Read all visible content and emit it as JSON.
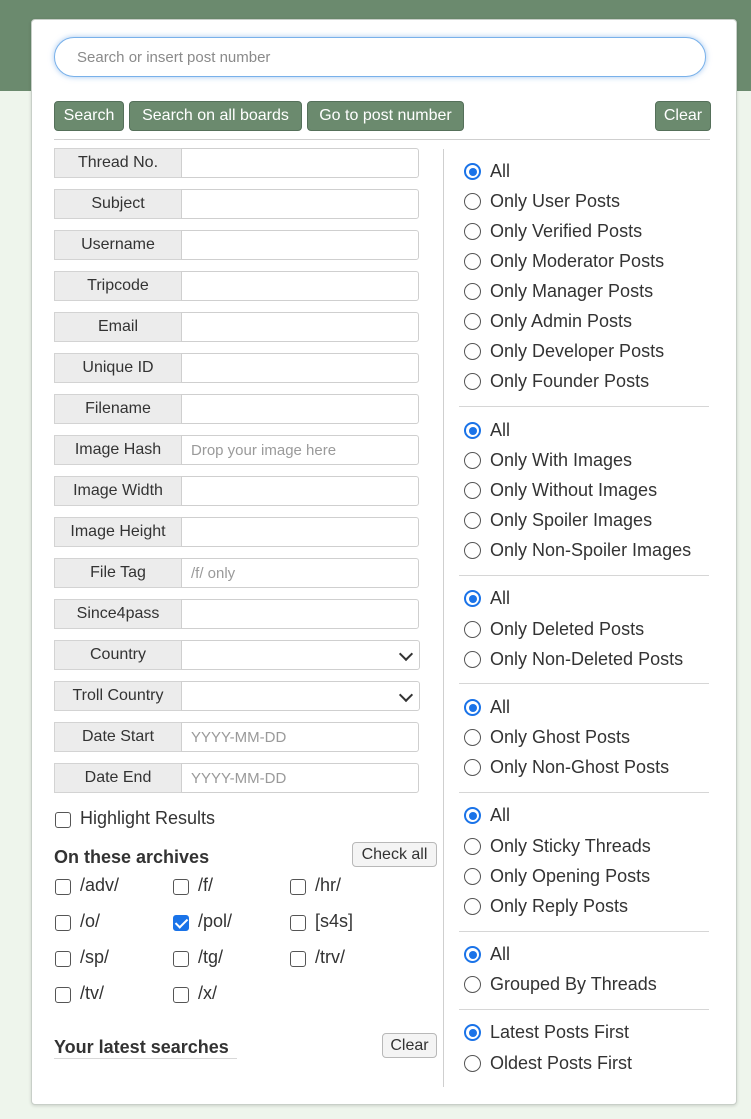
{
  "search": {
    "placeholder": "Search or insert post number"
  },
  "toolbar": {
    "search_label": "Search",
    "search_all_label": "Search on all boards",
    "goto_label": "Go to post number",
    "clear_label": "Clear"
  },
  "fields": {
    "thread_no": {
      "label": "Thread No.",
      "value": "",
      "placeholder": ""
    },
    "subject": {
      "label": "Subject",
      "value": "",
      "placeholder": ""
    },
    "username": {
      "label": "Username",
      "value": "",
      "placeholder": ""
    },
    "tripcode": {
      "label": "Tripcode",
      "value": "",
      "placeholder": ""
    },
    "email": {
      "label": "Email",
      "value": "",
      "placeholder": ""
    },
    "unique_id": {
      "label": "Unique ID",
      "value": "",
      "placeholder": ""
    },
    "filename": {
      "label": "Filename",
      "value": "",
      "placeholder": ""
    },
    "image_hash": {
      "label": "Image Hash",
      "value": "",
      "placeholder": "Drop your image here"
    },
    "image_width": {
      "label": "Image Width",
      "value": "",
      "placeholder": ""
    },
    "image_height": {
      "label": "Image Height",
      "value": "",
      "placeholder": ""
    },
    "file_tag": {
      "label": "File Tag",
      "value": "",
      "placeholder": "/f/ only"
    },
    "since4pass": {
      "label": "Since4pass",
      "value": "",
      "placeholder": ""
    },
    "country": {
      "label": "Country",
      "selected": ""
    },
    "troll_country": {
      "label": "Troll Country",
      "selected": ""
    },
    "date_start": {
      "label": "Date Start",
      "value": "",
      "placeholder": "YYYY-MM-DD"
    },
    "date_end": {
      "label": "Date End",
      "value": "",
      "placeholder": "YYYY-MM-DD"
    }
  },
  "highlight": {
    "label": "Highlight Results",
    "checked": false
  },
  "archives": {
    "heading": "On these archives",
    "check_all_label": "Check all",
    "boards": [
      {
        "label": "/adv/",
        "checked": false
      },
      {
        "label": "/f/",
        "checked": false
      },
      {
        "label": "/hr/",
        "checked": false
      },
      {
        "label": "/o/",
        "checked": false
      },
      {
        "label": "/pol/",
        "checked": true
      },
      {
        "label": "[s4s]",
        "checked": false
      },
      {
        "label": "/sp/",
        "checked": false
      },
      {
        "label": "/tg/",
        "checked": false
      },
      {
        "label": "/trv/",
        "checked": false
      },
      {
        "label": "/tv/",
        "checked": false
      },
      {
        "label": "/x/",
        "checked": false
      }
    ]
  },
  "latest": {
    "heading": "Your latest searches",
    "clear_label": "Clear"
  },
  "filters": {
    "poster_type": {
      "selected": "All",
      "options": [
        "All",
        "Only User Posts",
        "Only Verified Posts",
        "Only Moderator Posts",
        "Only Manager Posts",
        "Only Admin Posts",
        "Only Developer Posts",
        "Only Founder Posts"
      ]
    },
    "images": {
      "selected": "All",
      "options": [
        "All",
        "Only With Images",
        "Only Without Images",
        "Only Spoiler Images",
        "Only Non-Spoiler Images"
      ]
    },
    "deleted": {
      "selected": "All",
      "options": [
        "All",
        "Only Deleted Posts",
        "Only Non-Deleted Posts"
      ]
    },
    "ghost": {
      "selected": "All",
      "options": [
        "All",
        "Only Ghost Posts",
        "Only Non-Ghost Posts"
      ]
    },
    "post_type": {
      "selected": "All",
      "options": [
        "All",
        "Only Sticky Threads",
        "Only Opening Posts",
        "Only Reply Posts"
      ]
    },
    "grouping": {
      "selected": "All",
      "options": [
        "All",
        "Grouped By Threads"
      ]
    },
    "order": {
      "selected": "Latest Posts First",
      "options": [
        "Latest Posts First",
        "Oldest Posts First"
      ]
    }
  },
  "colors": {
    "brand": "#6b8a6e",
    "accent": "#1a73e8",
    "background": "#eef5ec"
  }
}
